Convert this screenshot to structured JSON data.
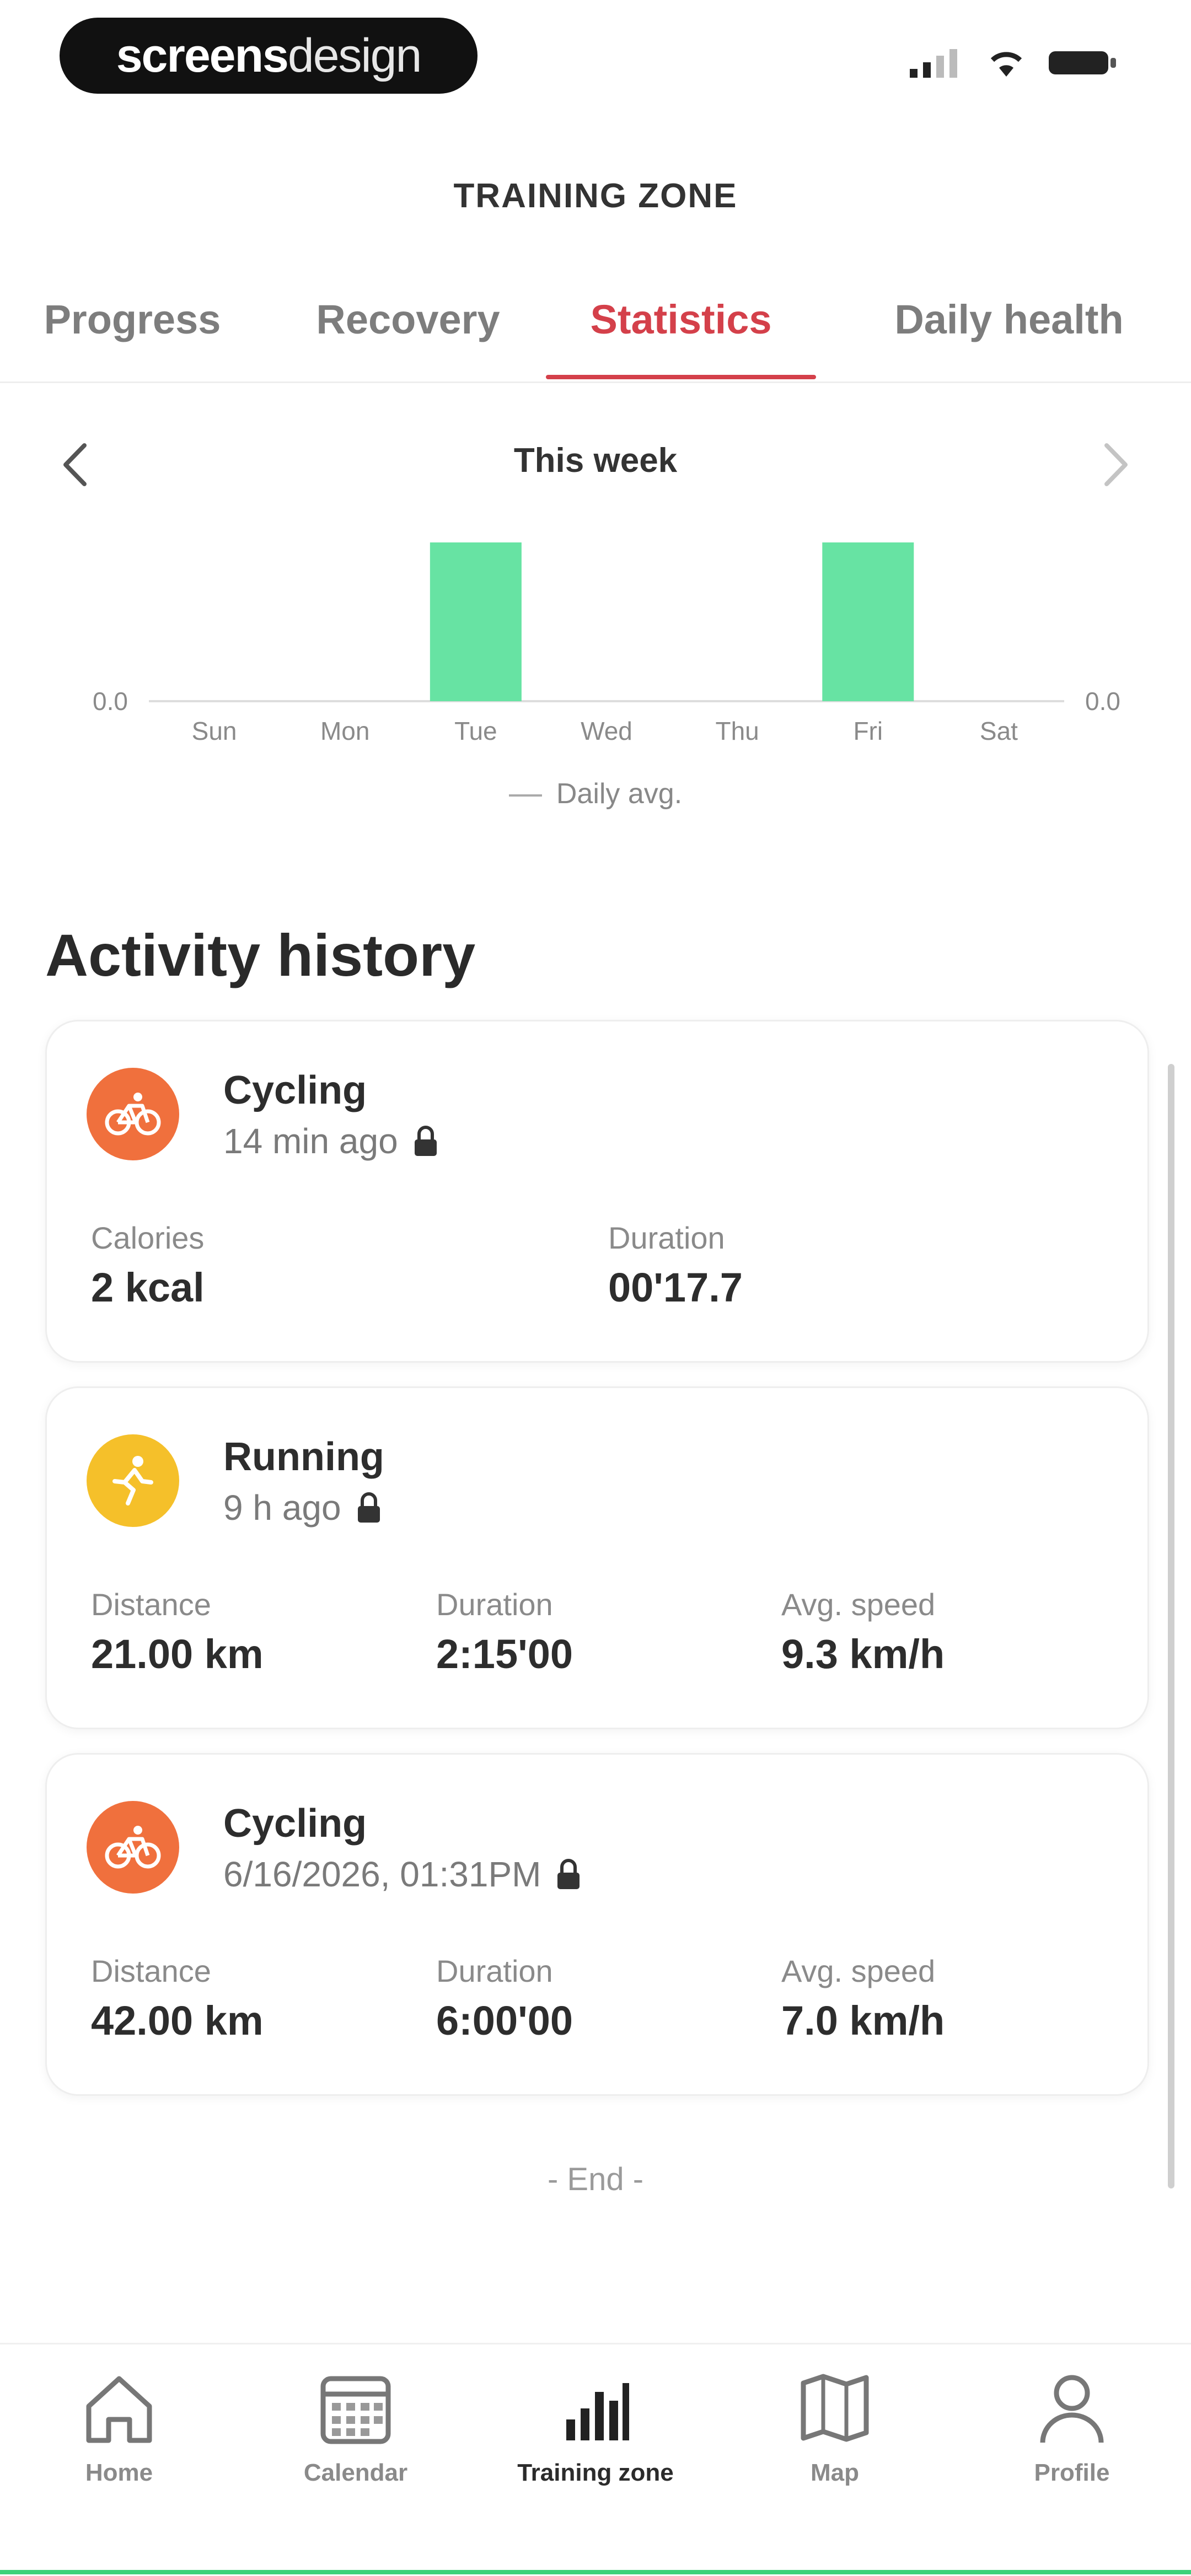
{
  "status_bar": {
    "brand_bold": "screens",
    "brand_light": "design"
  },
  "header": {
    "title": "TRAINING ZONE"
  },
  "tabs": [
    {
      "label": "Progress",
      "active": false
    },
    {
      "label": "Recovery",
      "active": false
    },
    {
      "label": "Statistics",
      "active": true
    },
    {
      "label": "Daily health",
      "active": false
    }
  ],
  "week": {
    "label": "This week"
  },
  "chart_data": {
    "type": "bar",
    "categories": [
      "Sun",
      "Mon",
      "Tue",
      "Wed",
      "Thu",
      "Fri",
      "Sat"
    ],
    "values": [
      0,
      0,
      1,
      0,
      0,
      1,
      0
    ],
    "y_left_tick": "0.0",
    "y_right_tick": "0.0",
    "bar_color": "#67e3a3",
    "legend": "Daily avg."
  },
  "activity": {
    "title": "Activity history",
    "items": [
      {
        "type": "Cycling",
        "time": "14 min ago",
        "icon": "bike-icon",
        "color": "#f0703d",
        "stats": [
          {
            "label": "Calories",
            "value": "2 kcal"
          },
          {
            "label": "Duration",
            "value": "00'17.7"
          }
        ]
      },
      {
        "type": "Running",
        "time": "9 h ago",
        "icon": "running-icon",
        "color": "#f5c02a",
        "stats": [
          {
            "label": "Distance",
            "value": "21.00 km"
          },
          {
            "label": "Duration",
            "value": "2:15'00"
          },
          {
            "label": "Avg. speed",
            "value": "9.3 km/h"
          }
        ]
      },
      {
        "type": "Cycling",
        "time": "6/16/2026, 01:31PM",
        "icon": "bike-icon",
        "color": "#f0703d",
        "stats": [
          {
            "label": "Distance",
            "value": "42.00 km"
          },
          {
            "label": "Duration",
            "value": "6:00'00"
          },
          {
            "label": "Avg. speed",
            "value": "7.0 km/h"
          }
        ]
      }
    ],
    "end_label": "- End -"
  },
  "bottom_nav": [
    {
      "label": "Home",
      "icon": "home-icon"
    },
    {
      "label": "Calendar",
      "icon": "calendar-icon"
    },
    {
      "label": "Training zone",
      "icon": "bar-chart-icon",
      "active": true
    },
    {
      "label": "Map",
      "icon": "map-icon"
    },
    {
      "label": "Profile",
      "icon": "profile-icon"
    }
  ]
}
